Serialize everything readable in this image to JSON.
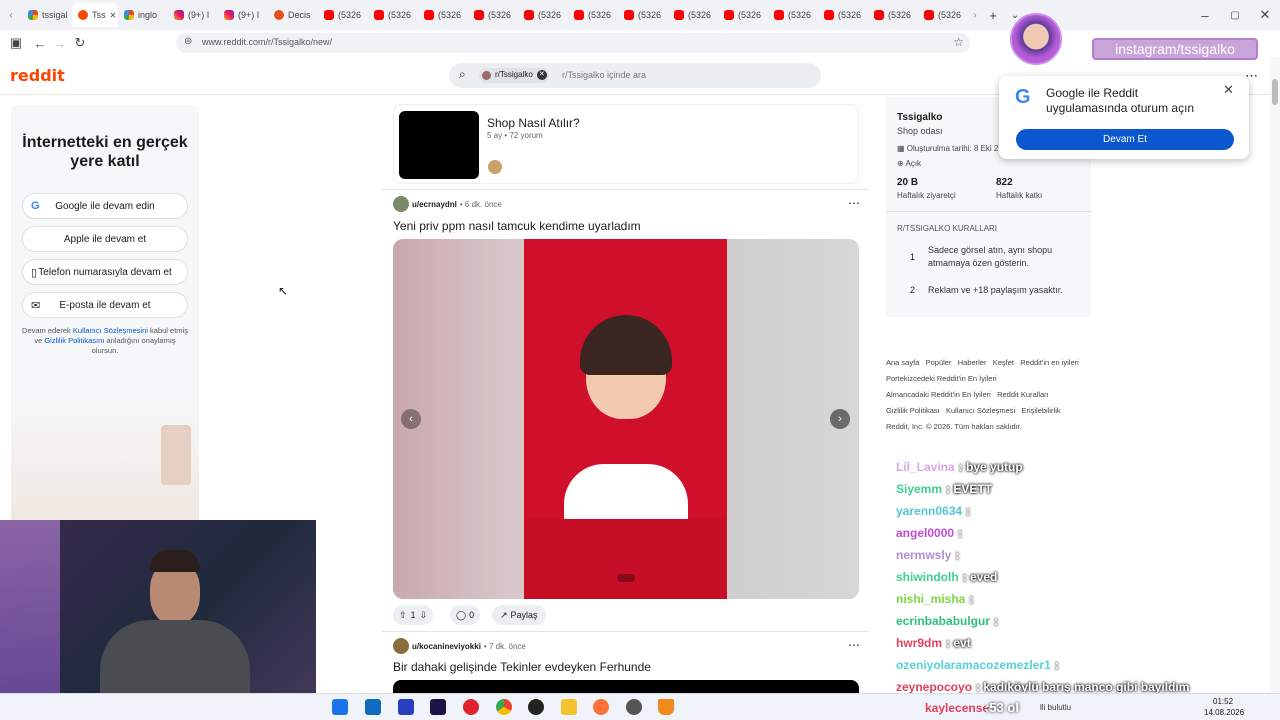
{
  "browser": {
    "tabs": [
      {
        "label": "tssigal",
        "icon": "google"
      },
      {
        "label": "Tss",
        "icon": "reddit",
        "active": true
      },
      {
        "label": "inglo",
        "icon": "google"
      },
      {
        "label": "(9+) I",
        "icon": "instagram"
      },
      {
        "label": "(9+) I",
        "icon": "instagram"
      },
      {
        "label": "Decis",
        "icon": "orange"
      },
      {
        "label": "(5326",
        "icon": "youtube"
      },
      {
        "label": "(5326",
        "icon": "youtube"
      },
      {
        "label": "(5326",
        "icon": "youtube"
      },
      {
        "label": "(5326",
        "icon": "youtube"
      },
      {
        "label": "(5326",
        "icon": "youtube"
      },
      {
        "label": "(5326",
        "icon": "youtube"
      },
      {
        "label": "(5326",
        "icon": "youtube"
      },
      {
        "label": "(5326",
        "icon": "youtube"
      },
      {
        "label": "(5326",
        "icon": "youtube"
      },
      {
        "label": "(5326",
        "icon": "youtube"
      },
      {
        "label": "(5326",
        "icon": "youtube"
      },
      {
        "label": "(5326",
        "icon": "youtube"
      },
      {
        "label": "(5326",
        "icon": "youtube"
      }
    ],
    "url": "www.reddit.com/r/Tssigalko/new/"
  },
  "reddit": {
    "logo": "reddit",
    "search_chip": "r/Tssigalko",
    "search_placeholder": "r/Tssigalko içinde ara"
  },
  "left": {
    "heading": "İnternetteki en gerçek yere katıl",
    "buttons": [
      "Google ile devam edin",
      "Apple ile devam et",
      "Telefon numarasıyla devam et",
      "E-posta ile devam et"
    ],
    "legal_prefix": "Devam ederek ",
    "legal_link1": "Kullanıcı Sözleşmesini",
    "legal_mid": " kabul etmiş ve ",
    "legal_link2": "Gizlilik Politikasını",
    "legal_suffix": " anladığını onaylamış olursun."
  },
  "feed": {
    "pinned_title": "Shop Nasıl Atılır?",
    "pinned_meta": "5 ay • 72 yorum",
    "post1": {
      "user": "u/ecrnaydnl",
      "time": "• 6 dk. önce",
      "title": "Yeni priv ppm nasıl tamcuk kendime uyarladım",
      "votes": "1",
      "comments": "0",
      "share": "Paylaş"
    },
    "post2": {
      "user": "u/kocanineviyokki",
      "time": "• 7 dk. önce",
      "title": "Bir dahaki gelişinde Tekinler evdeyken Ferhunde"
    }
  },
  "right": {
    "name": "Tssigalko",
    "subtitle": "Shop odası",
    "created": "Oluşturulma tarihi: 8 Eki 2",
    "status": "Açık",
    "visitors": "20 B",
    "visitors_label": "Haftalık ziyaretçi",
    "contrib": "822",
    "contrib_label": "Haftalık katkı",
    "rules_title": "R/TSSIGALKO KURALLARI",
    "rule1": "Sadece görsel atın, aynı shopu atmamaya özen gösterin.",
    "rule2": "Reklam ve +18 paylaşım yasaktır.",
    "footer1": "Ana sayfa   Popüler   Haberler   Keşfet   Reddit'in en iyileri",
    "footer2": "Portekizcedeki Reddit'in En İyileri",
    "footer3": "Almancadaki Reddit'in En İyileri   Reddit Kuralları",
    "footer4": "Gizlilik Politikası   Kullanıcı Sözleşmesi   Erişilebilirlik",
    "footer5": "Reddit, Inc. © 2026. Tüm hakları saklıdır."
  },
  "popup": {
    "text": "Google ile Reddit uygulamasında oturum açın",
    "button": "Devam Et"
  },
  "overlay": {
    "handle": "instagram/tssigalko"
  },
  "chat": [
    {
      "user": "Lil_Lavina",
      "msg": ": bye yutup",
      "color": "#d9a7e8"
    },
    {
      "user": "Siyemm",
      "msg": ": EVETT",
      "color": "#3ecf8e"
    },
    {
      "user": "yarenn0634",
      "msg": ":",
      "color": "#56c4d8"
    },
    {
      "user": "angel0000",
      "msg": ":",
      "color": "#c34bd3"
    },
    {
      "user": "nermwsly",
      "msg": ":",
      "color": "#b08ed0"
    },
    {
      "user": "shiwindolh",
      "msg": ": eved",
      "color": "#3ecf8e"
    },
    {
      "user": "nishi_misha",
      "msg": ":",
      "color": "#7bd83e"
    },
    {
      "user": "ecrinbababulgur",
      "msg": ":",
      "color": "#2ec07a"
    },
    {
      "user": "hwr9dm",
      "msg": ": evt",
      "color": "#e0415d"
    },
    {
      "user": "ozeniyolaramacozemezler1",
      "msg": ":",
      "color": "#56d0d8"
    },
    {
      "user": "zeynepocoyo",
      "msg": ": kadıköylü barış manco gibi bayıldım",
      "color": "#e0415d"
    }
  ],
  "taskbar": {
    "time": "01:52",
    "date": "14.08.2026",
    "tray_user": "kaylecense",
    "tray_score": ":53 ol",
    "tray_text": "lli bulutlu"
  },
  "colors": {
    "reddit": "#ff4500",
    "google_blue": "#0b57d0",
    "photo_red": "#d0102b"
  }
}
